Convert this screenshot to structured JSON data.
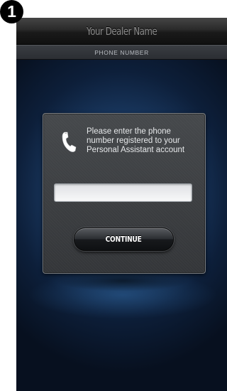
{
  "step": {
    "number": "1"
  },
  "header": {
    "title": "Your Dealer Name"
  },
  "subheader": {
    "label": "PHONE NUMBER"
  },
  "dialog": {
    "icon": "phone-handset-icon",
    "instruction": "Please enter the phone number registered  to your Personal Assistant account",
    "phone_input": {
      "value": "",
      "placeholder": ""
    },
    "continue_label": "CONTINUE"
  },
  "colors": {
    "background_blue": "#1b3b64",
    "title_bar": "#1a1a1a",
    "dialog_bg": "#3a3d40",
    "button_bg": "#17191c"
  }
}
